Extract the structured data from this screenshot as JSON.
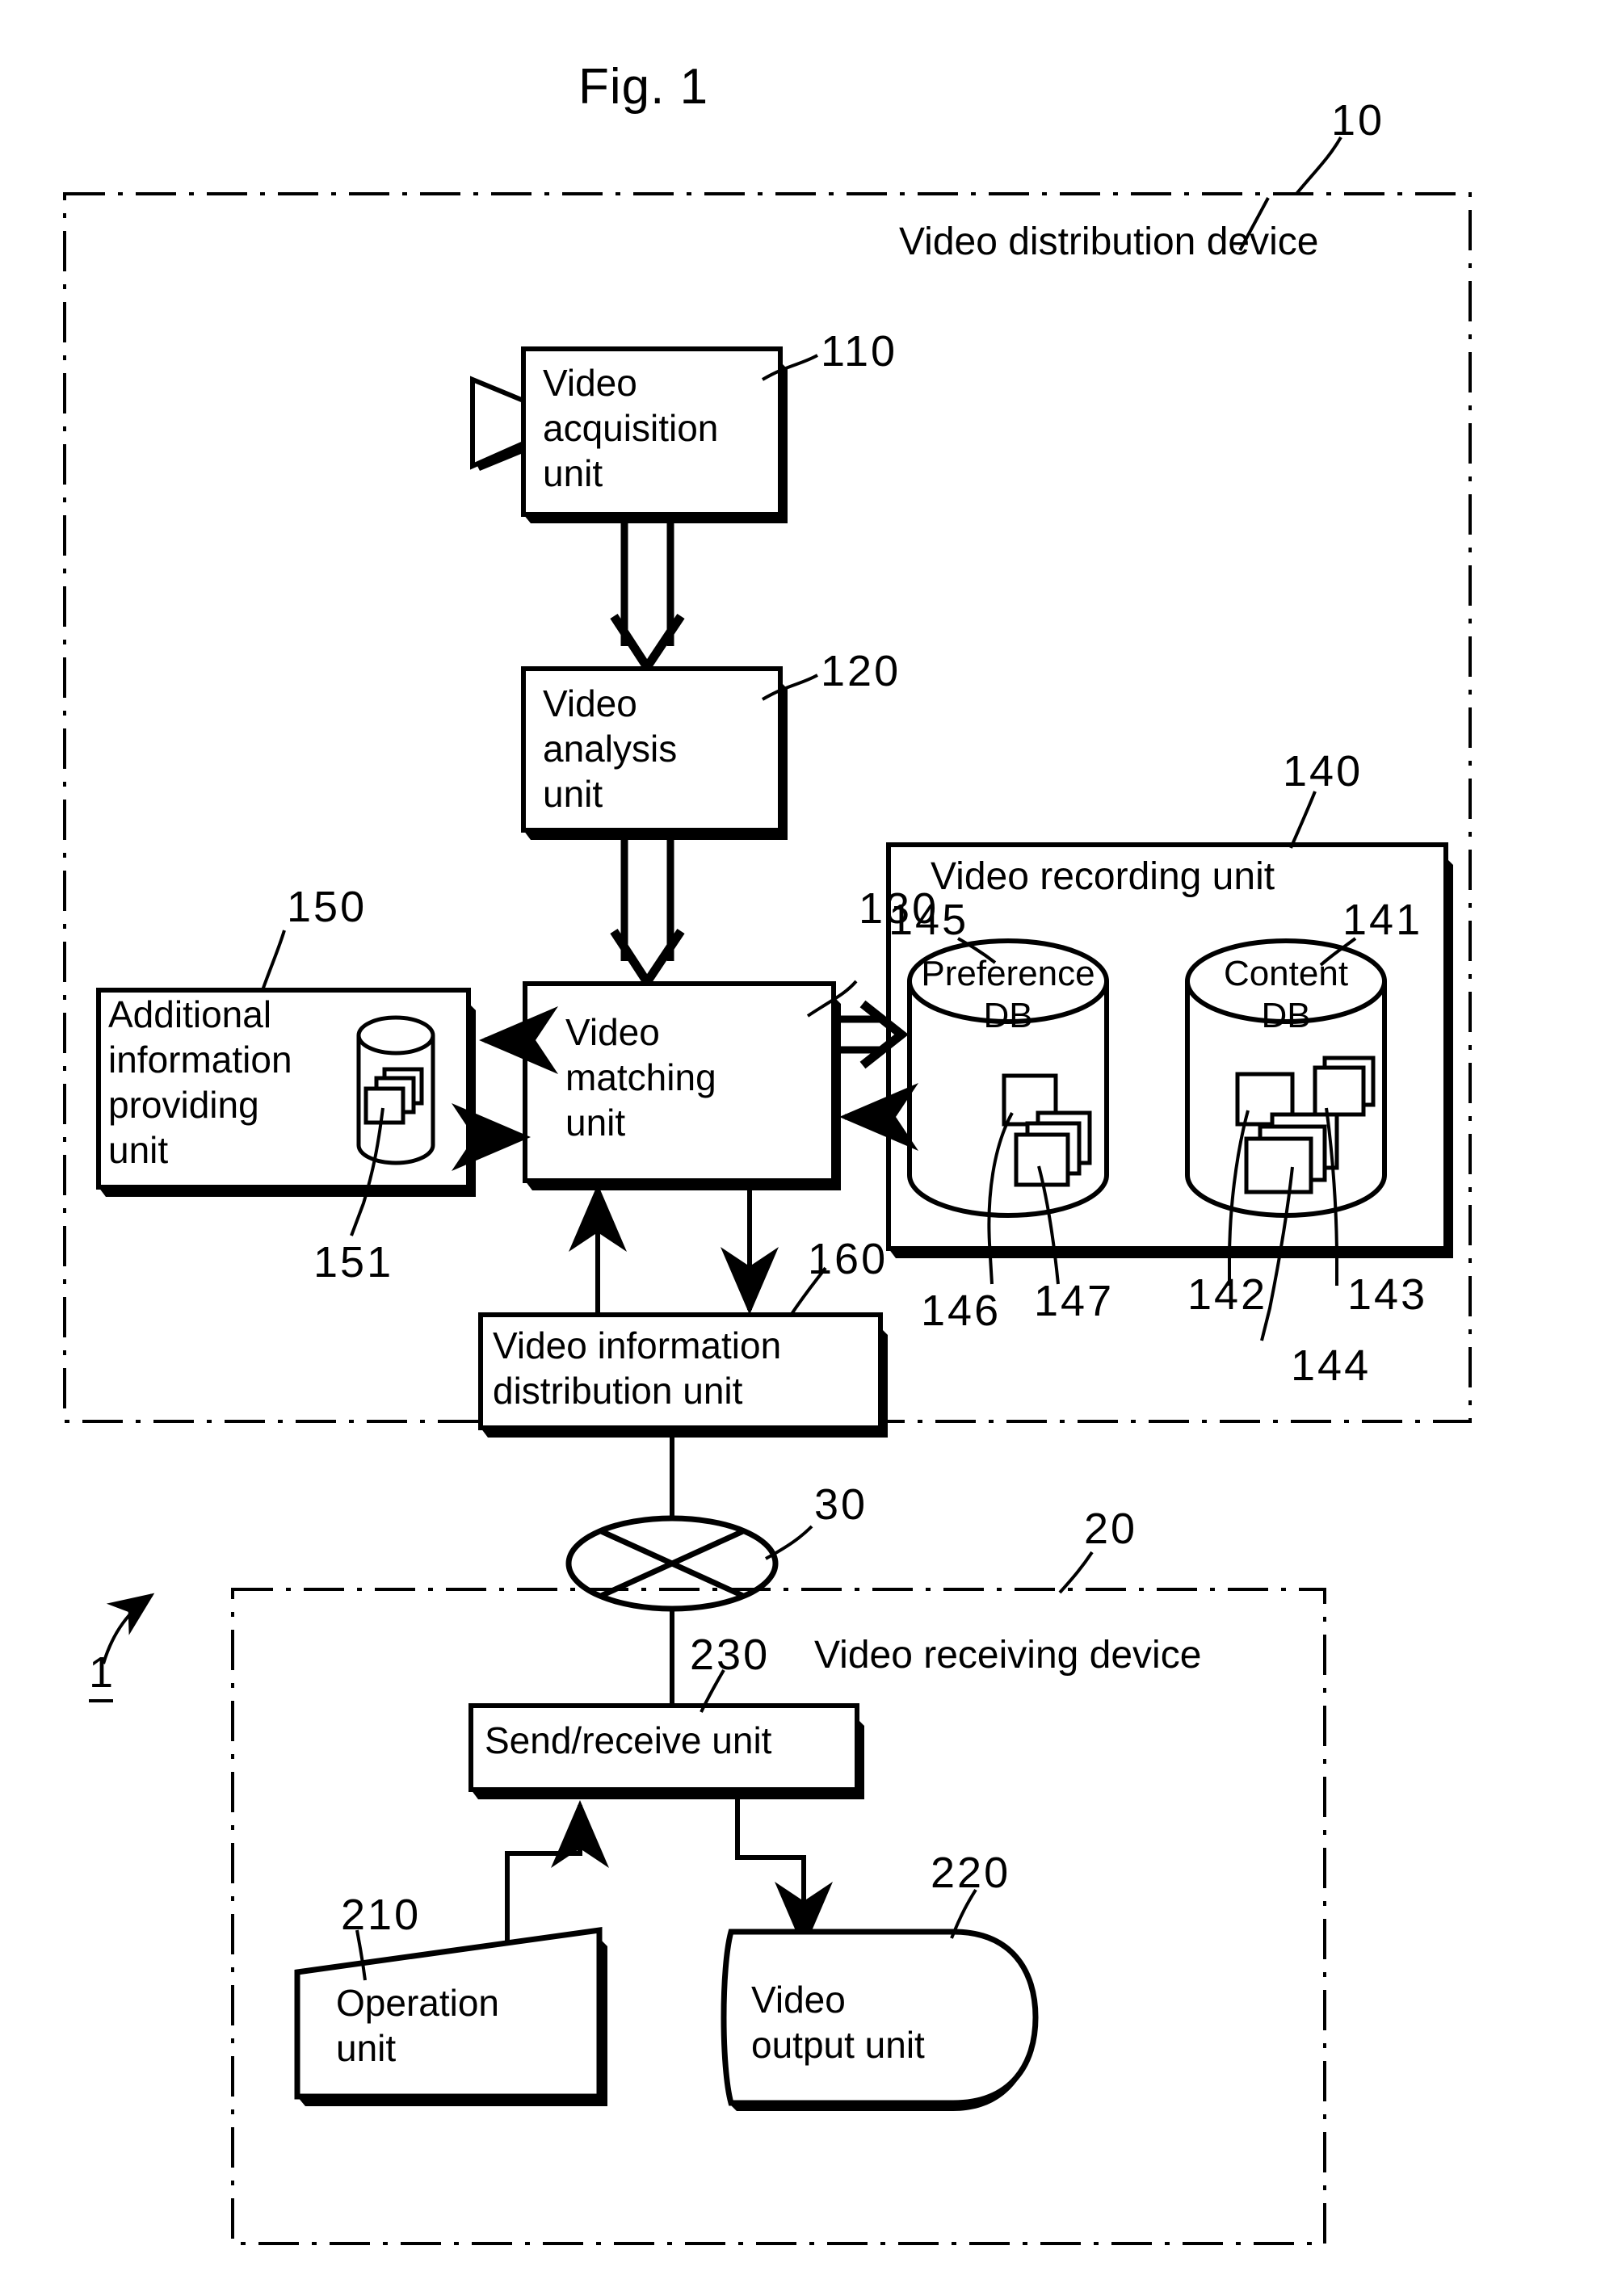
{
  "figure": {
    "title": "Fig. 1",
    "system_ref": "1"
  },
  "distribution_device": {
    "ref": "10",
    "label": "Video distribution device",
    "blocks": {
      "acquisition": {
        "ref": "110",
        "label": "Video\nacquisition\nunit"
      },
      "analysis": {
        "ref": "120",
        "label": "Video\nanalysis\nunit"
      },
      "matching": {
        "ref": "130",
        "label": "Video\nmatching\nunit"
      },
      "additional_info": {
        "ref": "150",
        "label": "Additional\ninformation\nproviding\nunit",
        "db_ref": "151"
      },
      "distribution": {
        "ref": "160",
        "label": "Video information\ndistribution unit"
      }
    },
    "recording_unit": {
      "ref": "140",
      "label": "Video recording unit",
      "databases": [
        {
          "ref": "145",
          "name": "Preference\nDB",
          "item_refs": [
            "146",
            "147"
          ]
        },
        {
          "ref": "141",
          "name": "Content\nDB",
          "item_refs": [
            "142",
            "143",
            "144"
          ]
        }
      ]
    }
  },
  "network": {
    "ref": "30",
    "icon": "network-cloud-icon"
  },
  "receiving_device": {
    "ref": "20",
    "label": "Video receiving device",
    "blocks": {
      "send_receive": {
        "ref": "230",
        "label": "Send/receive unit"
      },
      "operation": {
        "ref": "210",
        "label": "Operation\nunit"
      },
      "video_output": {
        "ref": "220",
        "label": "Video\noutput unit"
      }
    }
  },
  "colors": {
    "line": "#000000",
    "background": "#ffffff"
  }
}
